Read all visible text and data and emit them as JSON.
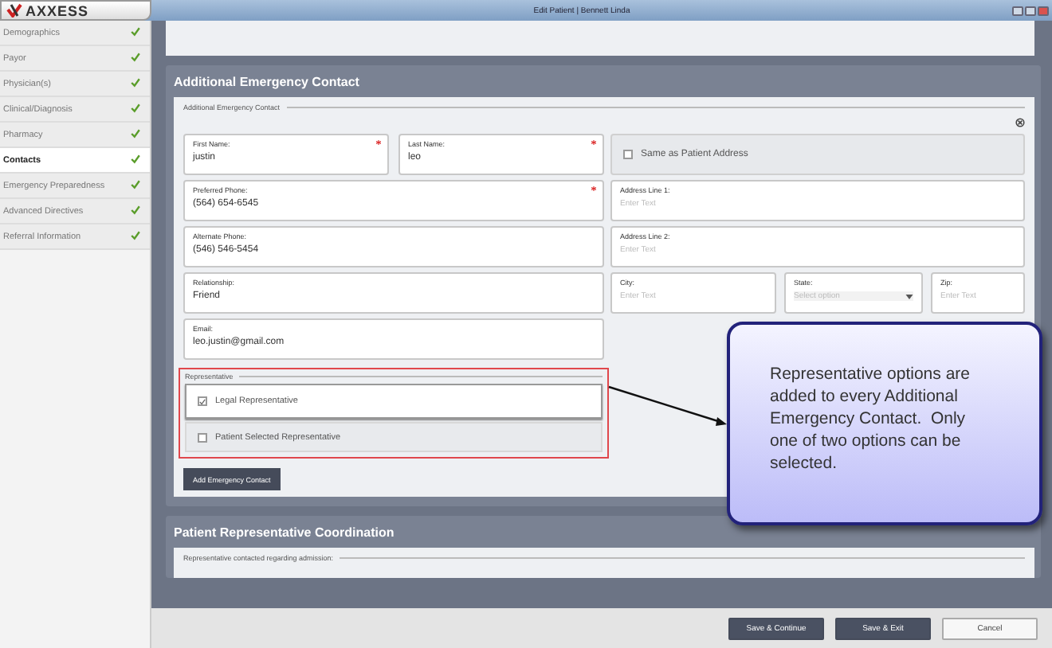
{
  "window": {
    "logo": "AXXESS",
    "title": "Edit Patient | Bennett Linda"
  },
  "sidebar": {
    "items": [
      {
        "label": "Demographics",
        "selected": false,
        "completed": true
      },
      {
        "label": "Payor",
        "selected": false,
        "completed": true
      },
      {
        "label": "Physician(s)",
        "selected": false,
        "completed": true
      },
      {
        "label": "Clinical/Diagnosis",
        "selected": false,
        "completed": true
      },
      {
        "label": "Pharmacy",
        "selected": false,
        "completed": true
      },
      {
        "label": "Contacts",
        "selected": true,
        "completed": true
      },
      {
        "label": "Emergency Preparedness",
        "selected": false,
        "completed": true
      },
      {
        "label": "Advanced Directives",
        "selected": false,
        "completed": true
      },
      {
        "label": "Referral Information",
        "selected": false,
        "completed": true
      }
    ]
  },
  "emergency_contact": {
    "title": "Additional Emergency Contact",
    "legend": "Additional Emergency Contact",
    "name_fields": [
      {
        "label": "First Name:",
        "value": "justin",
        "required": true
      },
      {
        "label": "Last Name:",
        "value": "leo",
        "required": true
      }
    ],
    "fields": [
      {
        "label": "Preferred Phone:",
        "value": "(564) 654-6545",
        "required": true
      },
      {
        "label": "Alternate Phone:",
        "value": "(546) 546-5454",
        "required": false
      },
      {
        "label": "Relationship:",
        "value": "Friend",
        "required": false
      },
      {
        "label": "Email:",
        "value": "leo.justin@gmail.com",
        "required": false
      }
    ],
    "same_as_patient_address": {
      "label": "Same as Patient Address",
      "checked": false
    },
    "address_fields": [
      {
        "label": "Address Line 1:",
        "placeholder": "Enter Text"
      },
      {
        "label": "Address Line 2:",
        "placeholder": "Enter Text"
      }
    ],
    "city": {
      "label": "City:",
      "placeholder": "Enter Text"
    },
    "state": {
      "label": "State:",
      "placeholder": "Select option"
    },
    "zip": {
      "label": "Zip:",
      "placeholder": "Enter Text"
    },
    "representative": {
      "legend": "Representative",
      "options": [
        {
          "label": "Legal Representative",
          "checked": true
        },
        {
          "label": "Patient Selected Representative",
          "checked": false
        }
      ]
    },
    "add_button": "Add Emergency Contact"
  },
  "callout": {
    "text": "Representative options are added to every Additional Emergency Contact.  Only one of two options can be selected."
  },
  "coordination": {
    "title": "Patient Representative Coordination",
    "legend": "Representative contacted regarding admission:"
  },
  "footer": {
    "buttons": [
      {
        "label": "Save & Continue",
        "kind": "primary"
      },
      {
        "label": "Save & Exit",
        "kind": "primary"
      },
      {
        "label": "Cancel",
        "kind": "secondary"
      }
    ]
  }
}
